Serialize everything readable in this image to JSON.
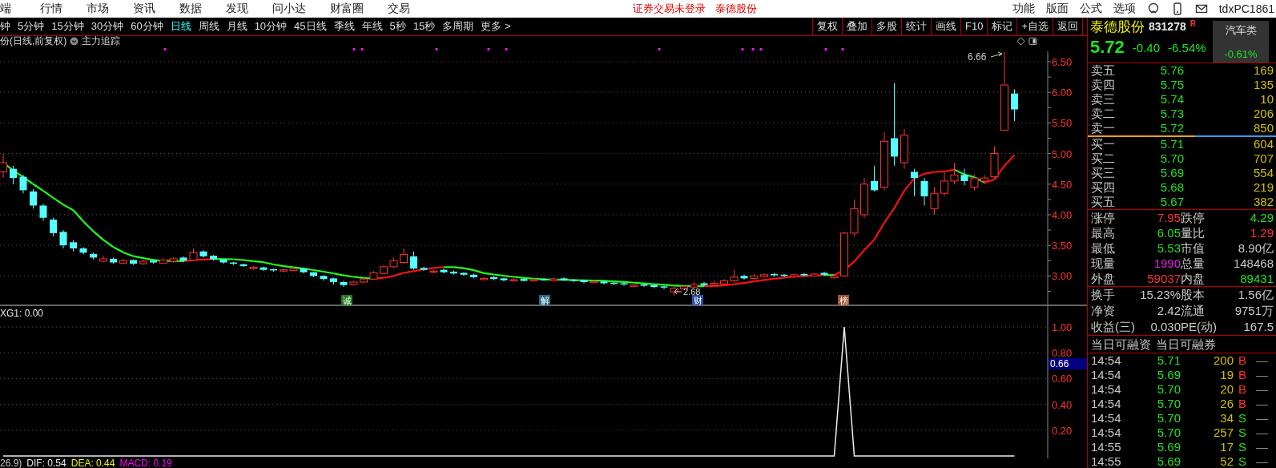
{
  "menu_bar": {
    "items": [
      "端",
      "行情",
      "市场",
      "资讯",
      "数据",
      "发现",
      "问小达",
      "财富圈",
      "交易"
    ],
    "notice": "证券交易未登录",
    "stock": "泰德股份",
    "right_items": [
      "功能",
      "版面",
      "公式",
      "选项"
    ],
    "user": "tdxPC1861"
  },
  "period_bar": {
    "periods": [
      {
        "label": "钟",
        "selected": false
      },
      {
        "label": "5分钟",
        "selected": false
      },
      {
        "label": "15分钟",
        "selected": false
      },
      {
        "label": "30分钟",
        "selected": false
      },
      {
        "label": "60分钟",
        "selected": false
      },
      {
        "label": "日线",
        "selected": true
      },
      {
        "label": "周线",
        "selected": false
      },
      {
        "label": "月线",
        "selected": false
      },
      {
        "label": "10分钟",
        "selected": false
      },
      {
        "label": "45日线",
        "selected": false
      },
      {
        "label": "季线",
        "selected": false
      },
      {
        "label": "年线",
        "selected": false
      },
      {
        "label": "5秒",
        "selected": false
      },
      {
        "label": "15秒",
        "selected": false
      },
      {
        "label": "多周期",
        "selected": false
      },
      {
        "label": "更多 >",
        "selected": false
      }
    ],
    "tools": [
      "复权",
      "叠加",
      "多股",
      "统计",
      "画线",
      "F10",
      "标记",
      "+自选",
      "返回"
    ]
  },
  "chart": {
    "title": "份(日线,前复权)",
    "indicator_name": "主力追踪",
    "chart_data": {
      "type": "candlestick",
      "grid": true,
      "ohlc": [
        [
          4.7,
          5.0,
          4.6,
          4.85
        ],
        [
          4.75,
          4.8,
          4.5,
          4.6
        ],
        [
          4.62,
          4.65,
          4.35,
          4.4
        ],
        [
          4.38,
          4.42,
          4.1,
          4.15
        ],
        [
          4.15,
          4.18,
          3.9,
          3.95
        ],
        [
          3.92,
          3.95,
          3.65,
          3.7
        ],
        [
          3.72,
          3.75,
          3.45,
          3.5
        ],
        [
          3.55,
          3.58,
          3.4,
          3.45
        ],
        [
          3.45,
          3.47,
          3.35,
          3.38
        ],
        [
          3.36,
          3.38,
          3.27,
          3.3
        ],
        [
          3.24,
          3.33,
          3.22,
          3.28
        ],
        [
          3.28,
          3.3,
          3.2,
          3.22
        ],
        [
          3.21,
          3.28,
          3.19,
          3.25
        ],
        [
          3.26,
          3.27,
          3.18,
          3.2
        ],
        [
          3.2,
          3.27,
          3.18,
          3.24
        ],
        [
          3.25,
          3.27,
          3.2,
          3.22
        ],
        [
          3.21,
          3.29,
          3.2,
          3.26
        ],
        [
          3.24,
          3.3,
          3.22,
          3.28
        ],
        [
          3.3,
          3.32,
          3.22,
          3.25
        ],
        [
          3.26,
          3.45,
          3.25,
          3.38
        ],
        [
          3.4,
          3.42,
          3.3,
          3.32
        ],
        [
          3.33,
          3.34,
          3.25,
          3.27
        ],
        [
          3.27,
          3.28,
          3.2,
          3.22
        ],
        [
          3.22,
          3.23,
          3.18,
          3.2
        ],
        [
          3.19,
          3.2,
          3.15,
          3.16
        ],
        [
          3.12,
          3.16,
          3.1,
          3.14
        ],
        [
          3.14,
          3.15,
          3.08,
          3.1
        ],
        [
          3.11,
          3.12,
          3.07,
          3.09
        ],
        [
          3.08,
          3.12,
          3.06,
          3.1
        ],
        [
          3.09,
          3.14,
          3.08,
          3.12
        ],
        [
          3.12,
          3.13,
          3.04,
          3.06
        ],
        [
          3.06,
          3.07,
          2.98,
          3.0
        ],
        [
          3.0,
          3.01,
          2.92,
          2.95
        ],
        [
          2.96,
          2.97,
          2.86,
          2.9
        ],
        [
          2.9,
          2.92,
          2.82,
          2.85
        ],
        [
          2.86,
          2.92,
          2.84,
          2.9
        ],
        [
          2.9,
          2.97,
          2.88,
          2.95
        ],
        [
          2.95,
          3.08,
          2.94,
          3.05
        ],
        [
          3.04,
          3.18,
          3.02,
          3.15
        ],
        [
          3.15,
          3.3,
          3.13,
          3.25
        ],
        [
          3.22,
          3.45,
          3.2,
          3.35
        ],
        [
          3.32,
          3.4,
          3.1,
          3.12
        ],
        [
          3.13,
          3.15,
          3.08,
          3.1
        ],
        [
          3.06,
          3.1,
          3.04,
          3.08
        ],
        [
          3.1,
          3.12,
          3.04,
          3.06
        ],
        [
          3.07,
          3.09,
          3.02,
          3.04
        ],
        [
          3.05,
          3.06,
          3.0,
          3.02
        ],
        [
          3.02,
          3.04,
          2.96,
          2.98
        ],
        [
          2.94,
          2.98,
          2.93,
          2.96
        ],
        [
          2.98,
          3.0,
          2.93,
          2.95
        ],
        [
          2.96,
          2.97,
          2.91,
          2.93
        ],
        [
          2.92,
          2.96,
          2.9,
          2.94
        ],
        [
          2.95,
          2.96,
          2.91,
          2.92
        ],
        [
          2.92,
          2.96,
          2.91,
          2.94
        ],
        [
          2.95,
          2.97,
          2.92,
          2.93
        ],
        [
          2.92,
          2.97,
          2.91,
          2.95
        ],
        [
          2.96,
          2.98,
          2.92,
          2.93
        ],
        [
          2.94,
          2.95,
          2.9,
          2.92
        ],
        [
          2.93,
          2.94,
          2.88,
          2.9
        ],
        [
          2.89,
          2.93,
          2.88,
          2.91
        ],
        [
          2.91,
          2.92,
          2.86,
          2.88
        ],
        [
          2.89,
          2.9,
          2.85,
          2.87
        ],
        [
          2.88,
          2.89,
          2.84,
          2.86
        ],
        [
          2.83,
          2.87,
          2.82,
          2.85
        ],
        [
          2.86,
          2.87,
          2.82,
          2.84
        ],
        [
          2.85,
          2.86,
          2.8,
          2.82
        ],
        [
          2.83,
          2.84,
          2.78,
          2.81
        ],
        [
          2.74,
          2.82,
          2.68,
          2.8
        ],
        [
          2.79,
          2.85,
          2.77,
          2.83
        ],
        [
          2.82,
          2.9,
          2.8,
          2.86
        ],
        [
          2.88,
          2.9,
          2.83,
          2.85
        ],
        [
          2.85,
          2.92,
          2.84,
          2.88
        ],
        [
          2.87,
          2.95,
          2.86,
          2.92
        ],
        [
          2.92,
          3.1,
          2.9,
          2.98
        ],
        [
          3.0,
          3.02,
          2.94,
          2.96
        ],
        [
          2.96,
          3.03,
          2.95,
          3.0
        ],
        [
          2.99,
          3.04,
          2.97,
          3.02
        ],
        [
          3.03,
          3.05,
          2.99,
          3.01
        ],
        [
          3.02,
          3.03,
          2.98,
          3.0
        ],
        [
          2.99,
          3.04,
          2.97,
          3.02
        ],
        [
          3.03,
          3.05,
          2.99,
          3.01
        ],
        [
          3.0,
          3.05,
          2.99,
          3.03
        ],
        [
          3.05,
          3.07,
          3.0,
          3.02
        ],
        [
          2.97,
          3.03,
          2.96,
          3.0
        ],
        [
          3.0,
          3.72,
          2.98,
          3.7
        ],
        [
          3.7,
          4.25,
          3.65,
          4.1
        ],
        [
          4.0,
          4.6,
          3.95,
          4.5
        ],
        [
          4.55,
          4.8,
          4.38,
          4.4
        ],
        [
          4.45,
          5.35,
          4.4,
          5.2
        ],
        [
          5.25,
          6.15,
          4.8,
          4.95
        ],
        [
          4.85,
          5.4,
          4.75,
          5.3
        ],
        [
          4.7,
          4.75,
          4.3,
          4.6
        ],
        [
          4.55,
          4.6,
          4.15,
          4.3
        ],
        [
          4.1,
          4.45,
          4.0,
          4.35
        ],
        [
          4.35,
          4.7,
          4.3,
          4.55
        ],
        [
          4.55,
          4.85,
          4.5,
          4.65
        ],
        [
          4.65,
          4.75,
          4.48,
          4.55
        ],
        [
          4.45,
          4.65,
          4.4,
          4.6
        ],
        [
          4.55,
          4.65,
          4.5,
          4.6
        ],
        [
          4.62,
          5.12,
          4.6,
          5.0
        ],
        [
          5.38,
          6.66,
          5.38,
          6.12
        ],
        [
          5.98,
          6.05,
          5.53,
          5.72
        ]
      ],
      "ylim": [
        2.52,
        6.67
      ],
      "yticks": [
        {
          "value": 6.5,
          "label": "6.50"
        },
        {
          "value": 6.0,
          "label": "6.00"
        },
        {
          "value": 5.5,
          "label": "5.50"
        },
        {
          "value": 5.0,
          "label": "5.00"
        },
        {
          "value": 4.5,
          "label": "4.50"
        },
        {
          "value": 4.0,
          "label": "4.00"
        },
        {
          "value": 3.5,
          "label": "3.50"
        },
        {
          "value": 3.0,
          "label": "3.00"
        }
      ]
    },
    "high_marker": "6.66",
    "low_marker": "2.68",
    "event_tags": [
      {
        "label": "诚",
        "color": "#1f7a1f"
      },
      {
        "label": "解",
        "color": "#1f6f80"
      },
      {
        "label": "财",
        "color": "#2a4fa0"
      },
      {
        "label": "榜",
        "color": "#a0522d"
      }
    ]
  },
  "indicator_panel": {
    "legend": "XG1: 0.00",
    "cursor_value": "0.66",
    "chart_data": {
      "type": "line",
      "grid": true,
      "ylim": [
        -0.019,
        1.168
      ],
      "yticks": [
        {
          "value": 1,
          "label": "1.00"
        },
        {
          "value": 0.8,
          "label": "0.80"
        },
        {
          "value": 0.6,
          "label": "0.60"
        },
        {
          "value": 0.4,
          "label": "0.40"
        },
        {
          "value": 0.2,
          "label": "0.20"
        }
      ],
      "series": [
        {
          "color": "#eeeeee",
          "values": [
            0,
            0,
            0,
            0,
            0,
            0,
            0,
            0,
            0,
            0,
            0,
            0,
            0,
            0,
            0,
            0,
            0,
            0,
            0,
            0,
            0,
            0,
            0,
            0,
            0,
            0,
            0,
            0,
            0,
            0,
            0,
            0,
            0,
            0,
            0,
            0,
            0,
            0,
            0,
            0,
            0,
            0,
            0,
            0,
            0,
            0,
            0,
            0,
            0,
            0,
            0,
            0,
            0,
            0,
            0,
            0,
            0,
            0,
            0,
            0,
            0,
            0,
            0,
            0,
            0,
            0,
            0,
            0,
            0,
            0,
            0,
            0,
            0,
            0,
            0,
            0,
            0,
            0,
            0,
            0,
            0,
            0,
            0,
            0,
            1,
            0,
            0,
            0,
            0,
            0,
            0,
            0,
            0,
            0,
            0,
            0,
            0,
            0,
            0,
            0,
            0,
            0
          ]
        }
      ]
    }
  },
  "macd_legend": [
    {
      "text": "26.9)",
      "color": "#c8c8c8"
    },
    {
      "text": "DIF: 0.54",
      "color": "#e6e6e6"
    },
    {
      "text": "DEA: 0.44",
      "color": "#f0f000"
    },
    {
      "text": "MACD: 0.19",
      "color": "#ff00ff"
    }
  ],
  "quote_panel": {
    "name": "泰德股份",
    "code": "831278",
    "badge": "R",
    "sector": "汽车类",
    "sector_change": "-0.61%",
    "price": "5.72",
    "change": "-0.40",
    "change_pct": "-6.54%",
    "asks": [
      {
        "label": "卖五",
        "price": "5.76",
        "volume": "169"
      },
      {
        "label": "卖四",
        "price": "5.75",
        "volume": "135"
      },
      {
        "label": "卖三",
        "price": "5.74",
        "volume": "10"
      },
      {
        "label": "卖二",
        "price": "5.73",
        "volume": "206"
      },
      {
        "label": "卖一",
        "price": "5.72",
        "volume": "850"
      }
    ],
    "order_balance": {
      "level": 0.57
    },
    "bids": [
      {
        "label": "买一",
        "price": "5.71",
        "volume": "604"
      },
      {
        "label": "买二",
        "price": "5.70",
        "volume": "707"
      },
      {
        "label": "买三",
        "price": "5.69",
        "volume": "554"
      },
      {
        "label": "买四",
        "price": "5.68",
        "volume": "219"
      },
      {
        "label": "买五",
        "price": "5.67",
        "volume": "382"
      }
    ],
    "stats": [
      [
        {
          "label": "涨停",
          "value": "7.95",
          "color": "#ff3232"
        },
        {
          "label": "跌停",
          "value": "4.29",
          "color": "#22e022"
        }
      ],
      [
        {
          "label": "最高",
          "value": "6.05",
          "color": "#22e022"
        },
        {
          "label": "量比",
          "value": "1.29",
          "color": "#ff3232"
        }
      ],
      [
        {
          "label": "最低",
          "value": "5.53",
          "color": "#22e022"
        },
        {
          "label": "市值",
          "value": "8.90亿",
          "color": "#c8c8c8"
        }
      ],
      [
        {
          "label": "现量",
          "value": "1990",
          "color": "#e020e0"
        },
        {
          "label": "总量",
          "value": "148468",
          "color": "#c8c8c8"
        }
      ],
      [
        {
          "label": "外盘",
          "value": "59037",
          "color": "#ff3232"
        },
        {
          "label": "内盘",
          "value": "89431",
          "color": "#22e022"
        }
      ]
    ],
    "finance": [
      [
        {
          "label": "换手",
          "value": "15.23%",
          "color": "#c8c8c8"
        },
        {
          "label": "股本",
          "value": "1.56亿",
          "color": "#c8c8c8"
        }
      ],
      [
        {
          "label": "净资",
          "value": "2.42",
          "color": "#c8c8c8"
        },
        {
          "label": "流通",
          "value": "9751万",
          "color": "#c8c8c8"
        }
      ],
      [
        {
          "label": "收益(三)",
          "value": "0.030",
          "color": "#c8c8c8"
        },
        {
          "label": "PE(动)",
          "value": "167.5",
          "color": "#c8c8c8"
        }
      ]
    ],
    "margin_header": [
      "当日可融资",
      "当日可融券"
    ],
    "ticks": [
      {
        "time": "14:54",
        "price": "5.71",
        "volume": "200",
        "side": "B",
        "kind": "buy",
        "mark": "—"
      },
      {
        "time": "14:54",
        "price": "5.69",
        "volume": "19",
        "side": "B",
        "kind": "buy",
        "mark": "—"
      },
      {
        "time": "14:54",
        "price": "5.70",
        "volume": "20",
        "side": "B",
        "kind": "buy",
        "mark": "—"
      },
      {
        "time": "14:54",
        "price": "5.70",
        "volume": "26",
        "side": "B",
        "kind": "buy",
        "mark": "—"
      },
      {
        "time": "14:54",
        "price": "5.70",
        "volume": "34",
        "side": "S",
        "kind": "sell",
        "mark": "—"
      },
      {
        "time": "14:54",
        "price": "5.70",
        "volume": "257",
        "side": "S",
        "kind": "sell",
        "mark": "—"
      },
      {
        "time": "14:55",
        "price": "5.69",
        "volume": "17",
        "side": "S",
        "kind": "sell",
        "mark": "—"
      },
      {
        "time": "14:55",
        "price": "5.69",
        "volume": "52",
        "side": "S",
        "kind": "sell",
        "mark": "—"
      }
    ]
  }
}
